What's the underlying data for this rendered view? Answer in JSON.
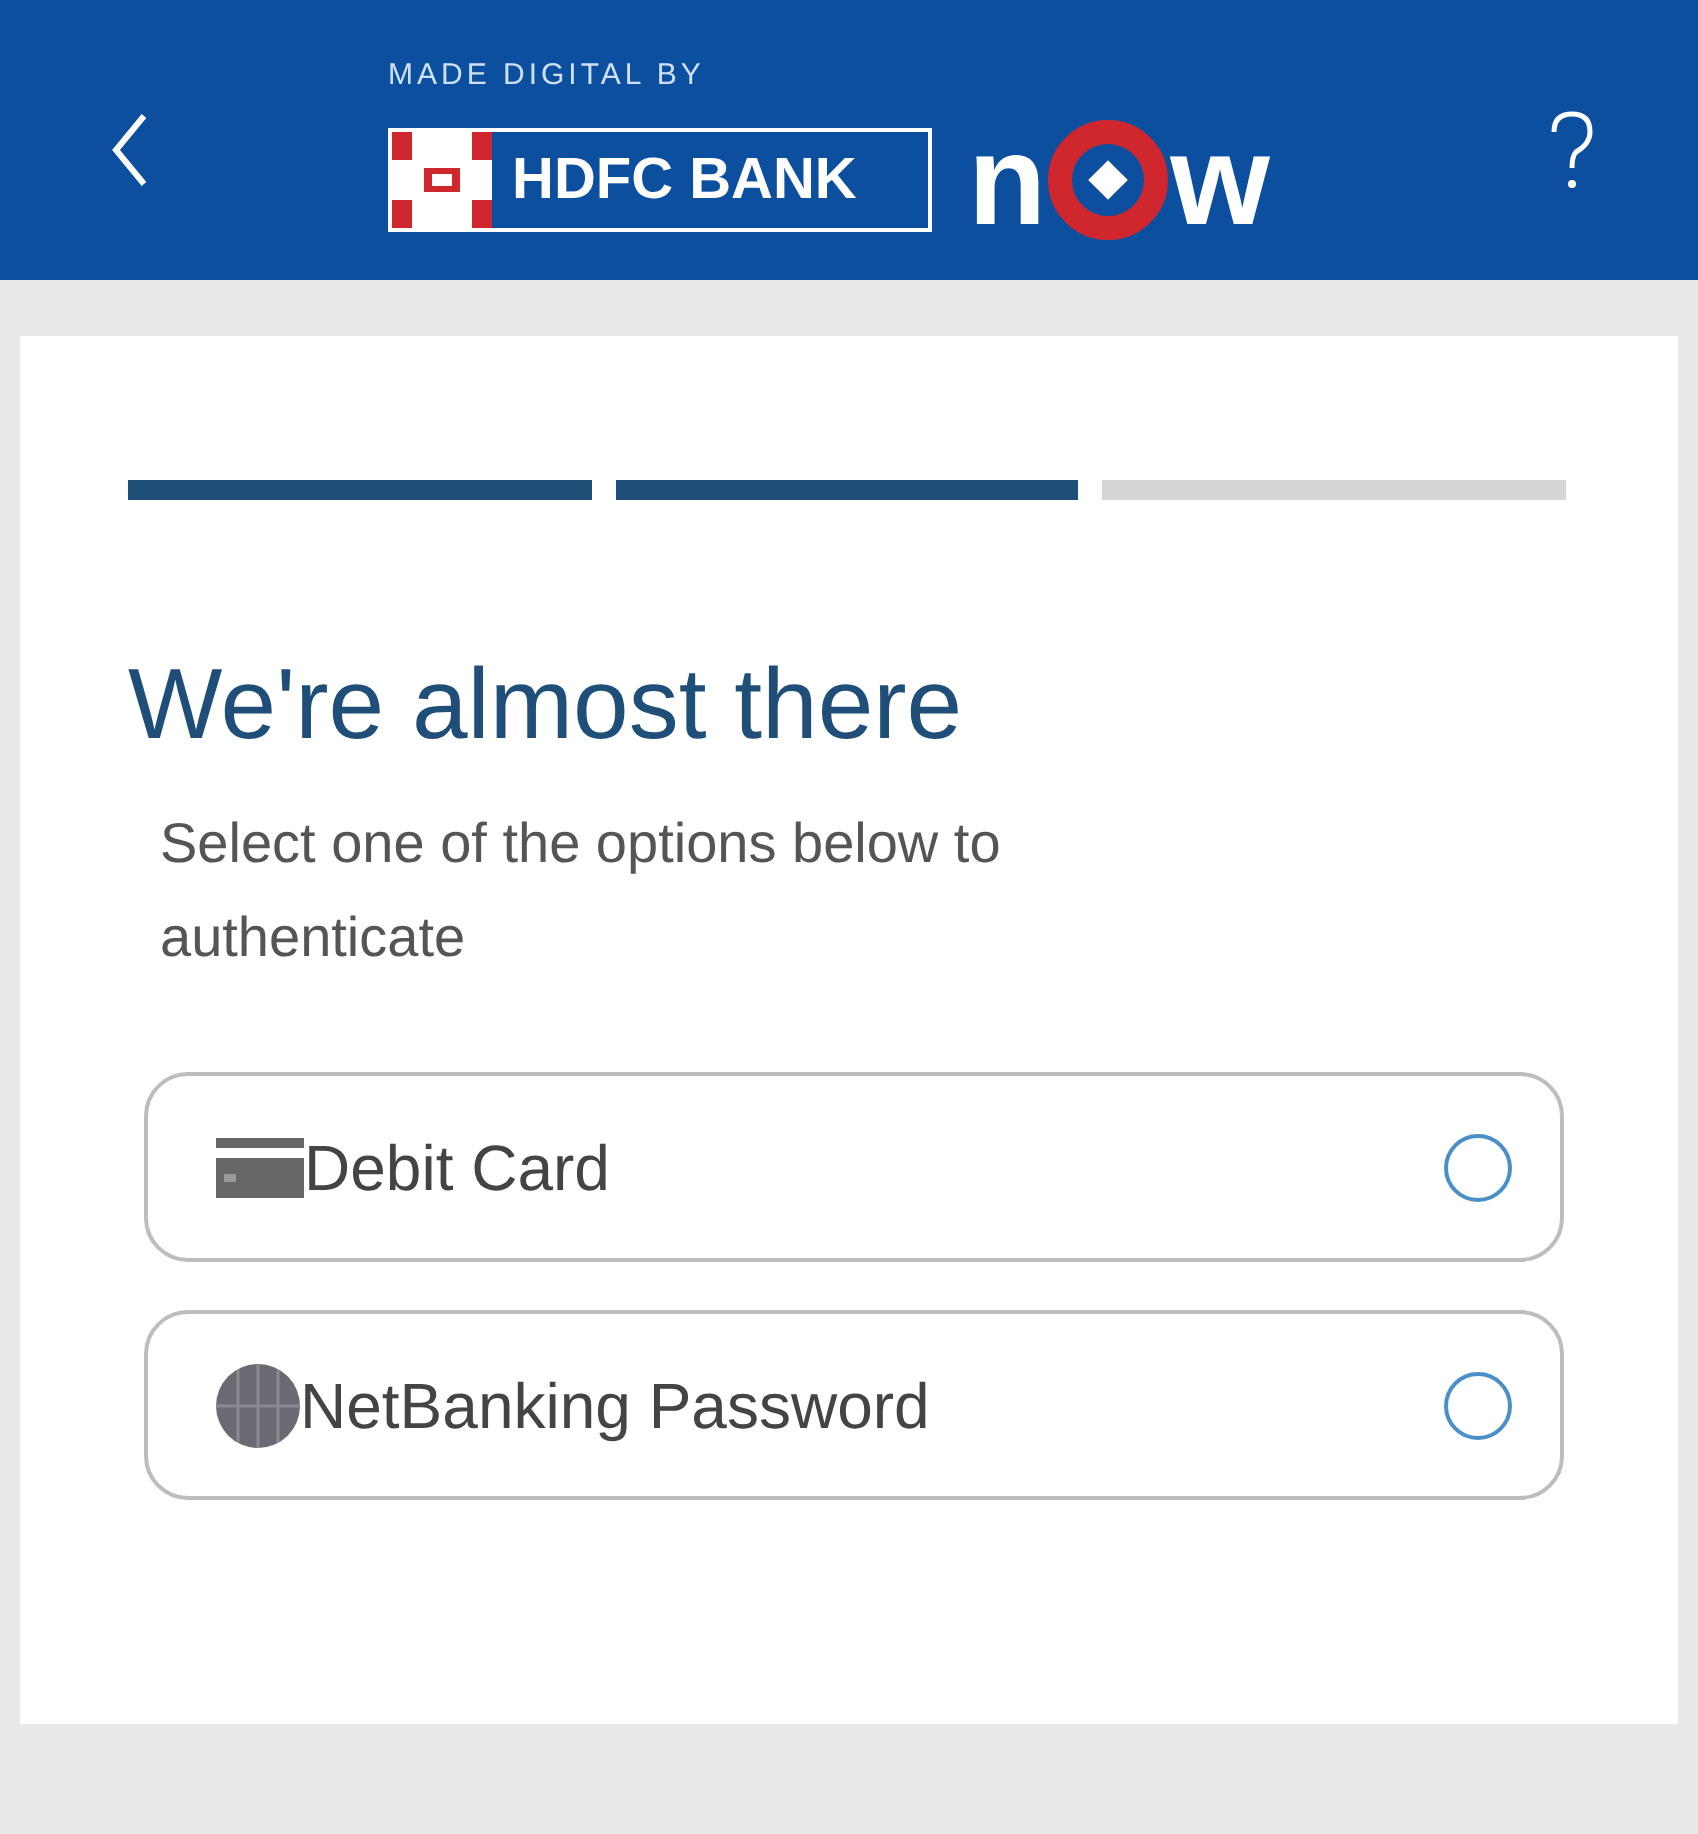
{
  "header": {
    "tagline": "MADE DIGITAL BY",
    "bank_name": "HDFC BANK",
    "logo_letters": [
      "n",
      "w"
    ]
  },
  "progress": [
    {
      "done": true
    },
    {
      "done": true
    },
    {
      "done": false
    }
  ],
  "title": "We're almost there",
  "subtitle": "Select one of the options below to authenticate",
  "options": [
    {
      "kind": "card",
      "label": "Debit Card",
      "selected": false
    },
    {
      "kind": "globe",
      "label": "NetBanking Password",
      "selected": false
    }
  ]
}
